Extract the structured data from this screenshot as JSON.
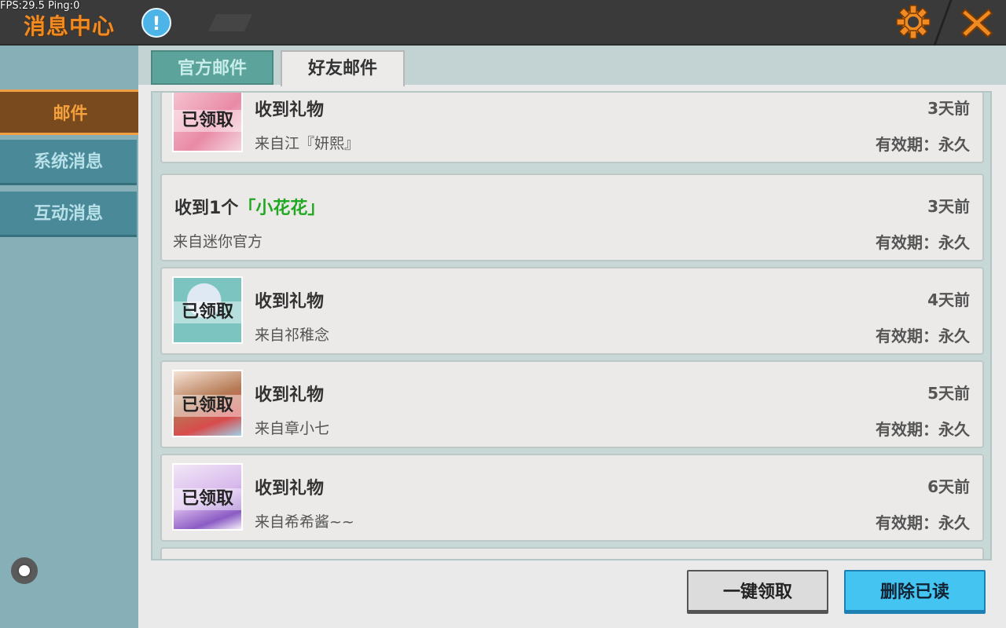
{
  "debug": {
    "fps_text": "FPS:29.5  Ping:0"
  },
  "header": {
    "title": "消息中心",
    "info_icon_text": "!"
  },
  "icons": {
    "info": "info-icon",
    "settings": "gear-icon",
    "close": "close-icon"
  },
  "colors": {
    "accent_orange": "#f08a22",
    "tab_teal": "#5ca39b",
    "highlight_green": "#21a821",
    "button_blue": "#44c4f0"
  },
  "sidebar": {
    "items": [
      {
        "label": "邮件",
        "active": true
      },
      {
        "label": "系统消息",
        "active": false
      },
      {
        "label": "互动消息",
        "active": false
      }
    ]
  },
  "tabs": [
    {
      "label": "官方邮件",
      "active": false
    },
    {
      "label": "好友邮件",
      "active": true
    }
  ],
  "mails": [
    {
      "title": "收到礼物",
      "from": "来自江『妍熙』",
      "time": "3天前",
      "validity": "有效期：永久",
      "badge": "已领取"
    },
    {
      "title_prefix": "收到1个",
      "title_item": "「小花花」",
      "from": "来自迷你官方",
      "time": "3天前",
      "validity": "有效期：永久"
    },
    {
      "title": "收到礼物",
      "from": "来自祁稚念",
      "time": "4天前",
      "validity": "有效期：永久",
      "badge": "已领取"
    },
    {
      "title": "收到礼物",
      "from": "来自章小七",
      "time": "5天前",
      "validity": "有效期：永久",
      "badge": "已领取"
    },
    {
      "title": "收到礼物",
      "from": "来自希希酱~~",
      "time": "6天前",
      "validity": "有效期：永久",
      "badge": "已领取"
    }
  ],
  "actions": {
    "claim_all": "一键领取",
    "delete_read": "删除已读"
  }
}
